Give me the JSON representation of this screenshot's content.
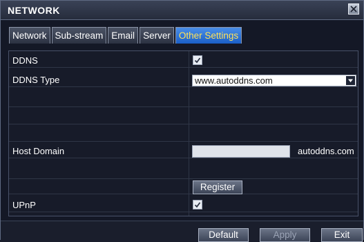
{
  "window": {
    "title": "NETWORK"
  },
  "tabs": [
    {
      "label": "Network",
      "active": false
    },
    {
      "label": "Sub-stream",
      "active": false
    },
    {
      "label": "Email",
      "active": false
    },
    {
      "label": "Server",
      "active": false
    },
    {
      "label": "Other Settings",
      "active": true
    }
  ],
  "settings": {
    "ddns": {
      "label": "DDNS",
      "checked": true
    },
    "ddns_type": {
      "label": "DDNS Type",
      "value": "www.autoddns.com"
    },
    "host_domain": {
      "label": "Host Domain",
      "value": "",
      "suffix": "autoddns.com"
    },
    "register_label": "Register",
    "upnp": {
      "label": "UPnP",
      "checked": true
    }
  },
  "footer": {
    "default_label": "Default",
    "apply_label": "Apply",
    "exit_label": "Exit"
  },
  "colors": {
    "active_tab": "#1b5fc7",
    "active_tab_text": "#ffe35a",
    "background": "#141826"
  }
}
